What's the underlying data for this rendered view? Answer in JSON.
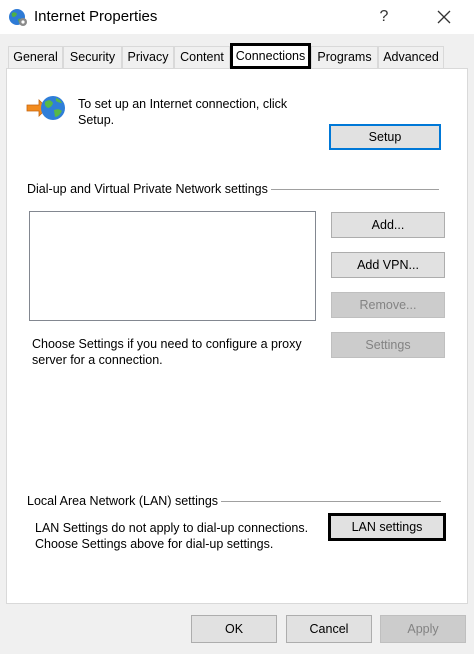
{
  "window": {
    "title": "Internet Properties",
    "help_glyph": "?",
    "icon": "globe-settings-icon"
  },
  "tabs": [
    {
      "label": "General"
    },
    {
      "label": "Security"
    },
    {
      "label": "Privacy"
    },
    {
      "label": "Content"
    },
    {
      "label": "Connections",
      "active": true
    },
    {
      "label": "Programs"
    },
    {
      "label": "Advanced"
    }
  ],
  "setup": {
    "text": "To set up an Internet connection, click Setup.",
    "button": "Setup",
    "icon": "globe-arrow-icon"
  },
  "dialup": {
    "section_label": "Dial-up and Virtual Private Network settings",
    "add_button": "Add...",
    "add_vpn_button": "Add VPN...",
    "remove_button": "Remove...",
    "settings_button": "Settings",
    "proxy_text": "Choose Settings if you need to configure a proxy server for a connection."
  },
  "lan": {
    "section_label": "Local Area Network (LAN) settings",
    "text": "LAN Settings do not apply to dial-up connections. Choose Settings above for dial-up settings.",
    "button": "LAN settings"
  },
  "footer": {
    "ok": "OK",
    "cancel": "Cancel",
    "apply": "Apply"
  },
  "colors": {
    "accent": "#0078d7",
    "highlight_border": "#000000"
  }
}
